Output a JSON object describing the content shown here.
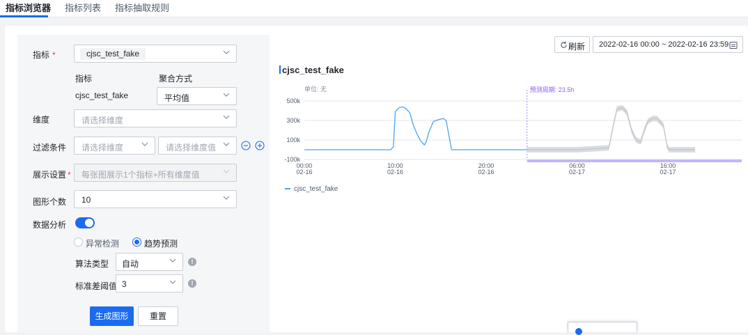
{
  "tabs": [
    {
      "label": "指标浏览器",
      "active": true
    },
    {
      "label": "指标列表",
      "active": false
    },
    {
      "label": "指标抽取规则",
      "active": false
    }
  ],
  "form": {
    "metric_label": "指标",
    "metric_chip": "cjsc_test_fake",
    "sub_header_metric": "指标",
    "sub_header_agg": "聚合方式",
    "sub_metric_name": "cjsc_test_fake",
    "agg_value": "平均值",
    "dimension_label": "维度",
    "dimension_placeholder": "请选择维度",
    "filter_label": "过滤条件",
    "filter_dim_placeholder": "请选择维度",
    "filter_val_placeholder": "请选择维度值",
    "display_label": "展示设置",
    "display_value": "每张图展示1个指标+所有维度值",
    "graph_count_label": "图形个数",
    "graph_count_value": "10",
    "analysis_label": "数据分析",
    "analysis_enabled": true,
    "radio_anomaly": "异常检测",
    "radio_trend": "趋势预测",
    "radio_selected": "趋势预测",
    "algo_label": "算法类型",
    "algo_value": "自动",
    "std_label": "标准差阈值",
    "std_value": "3",
    "generate_button": "生成图形",
    "reset_button": "重置"
  },
  "toolbar": {
    "refresh_label": "刷新",
    "time_range": "2022-02-16 00:00 ~ 2022-02-16 23:59"
  },
  "chart_data": {
    "type": "line",
    "title": "cjsc_test_fake",
    "unit_label": "单位: 无",
    "forecast_label": "预测周期: 23.5h",
    "xlabel": "",
    "ylabel": "",
    "ylim": [
      -100000,
      500000
    ],
    "yticks": [
      {
        "v": 500000,
        "label": "500k"
      },
      {
        "v": 300000,
        "label": "300k"
      },
      {
        "v": 100000,
        "label": "100k"
      },
      {
        "v": -100000,
        "label": "-100k"
      }
    ],
    "xlim": [
      0,
      38
    ],
    "xticks": [
      {
        "h": 0,
        "l1": "00:00",
        "l2": "02-16"
      },
      {
        "h": 10,
        "l1": "10:00",
        "l2": "02-16"
      },
      {
        "h": 20,
        "l1": "20:00",
        "l2": "02-16"
      },
      {
        "h": 30,
        "l1": "06:00",
        "l2": "02-17"
      },
      {
        "h": 40,
        "l1": "16:00",
        "l2": "02-17"
      }
    ],
    "forecast_start_h": 24.5,
    "series": [
      {
        "name": "cjsc_test_fake",
        "color": "#4aa3f0",
        "x": [
          0,
          9.5,
          9.8,
          10,
          10.4,
          10.8,
          11.2,
          11.6,
          12,
          12.4,
          12.8,
          13.2,
          13.4,
          13.7,
          14.2,
          14.8,
          15.3,
          15.6,
          15.9,
          16.2,
          24.5
        ],
        "y": [
          0,
          0,
          30000,
          390000,
          430000,
          440000,
          420000,
          380000,
          250000,
          160000,
          90000,
          50000,
          80000,
          180000,
          290000,
          310000,
          320000,
          300000,
          150000,
          0,
          0
        ]
      }
    ],
    "forecast": {
      "color": "#a8adb5",
      "x": [
        24.5,
        30,
        33.5,
        34,
        34.4,
        35,
        35.5,
        36,
        36.5,
        37,
        37.4,
        37.8,
        38.3,
        38.8,
        39.5,
        39.9,
        40.1,
        40.3,
        41,
        43
      ],
      "y": [
        0,
        0,
        20000,
        250000,
        420000,
        430000,
        380000,
        200000,
        100000,
        80000,
        200000,
        290000,
        320000,
        320000,
        250000,
        40000,
        0,
        0,
        0,
        0
      ]
    },
    "legend": [
      {
        "name": "cjsc_test_fake",
        "color": "#4aa3f0"
      }
    ]
  }
}
